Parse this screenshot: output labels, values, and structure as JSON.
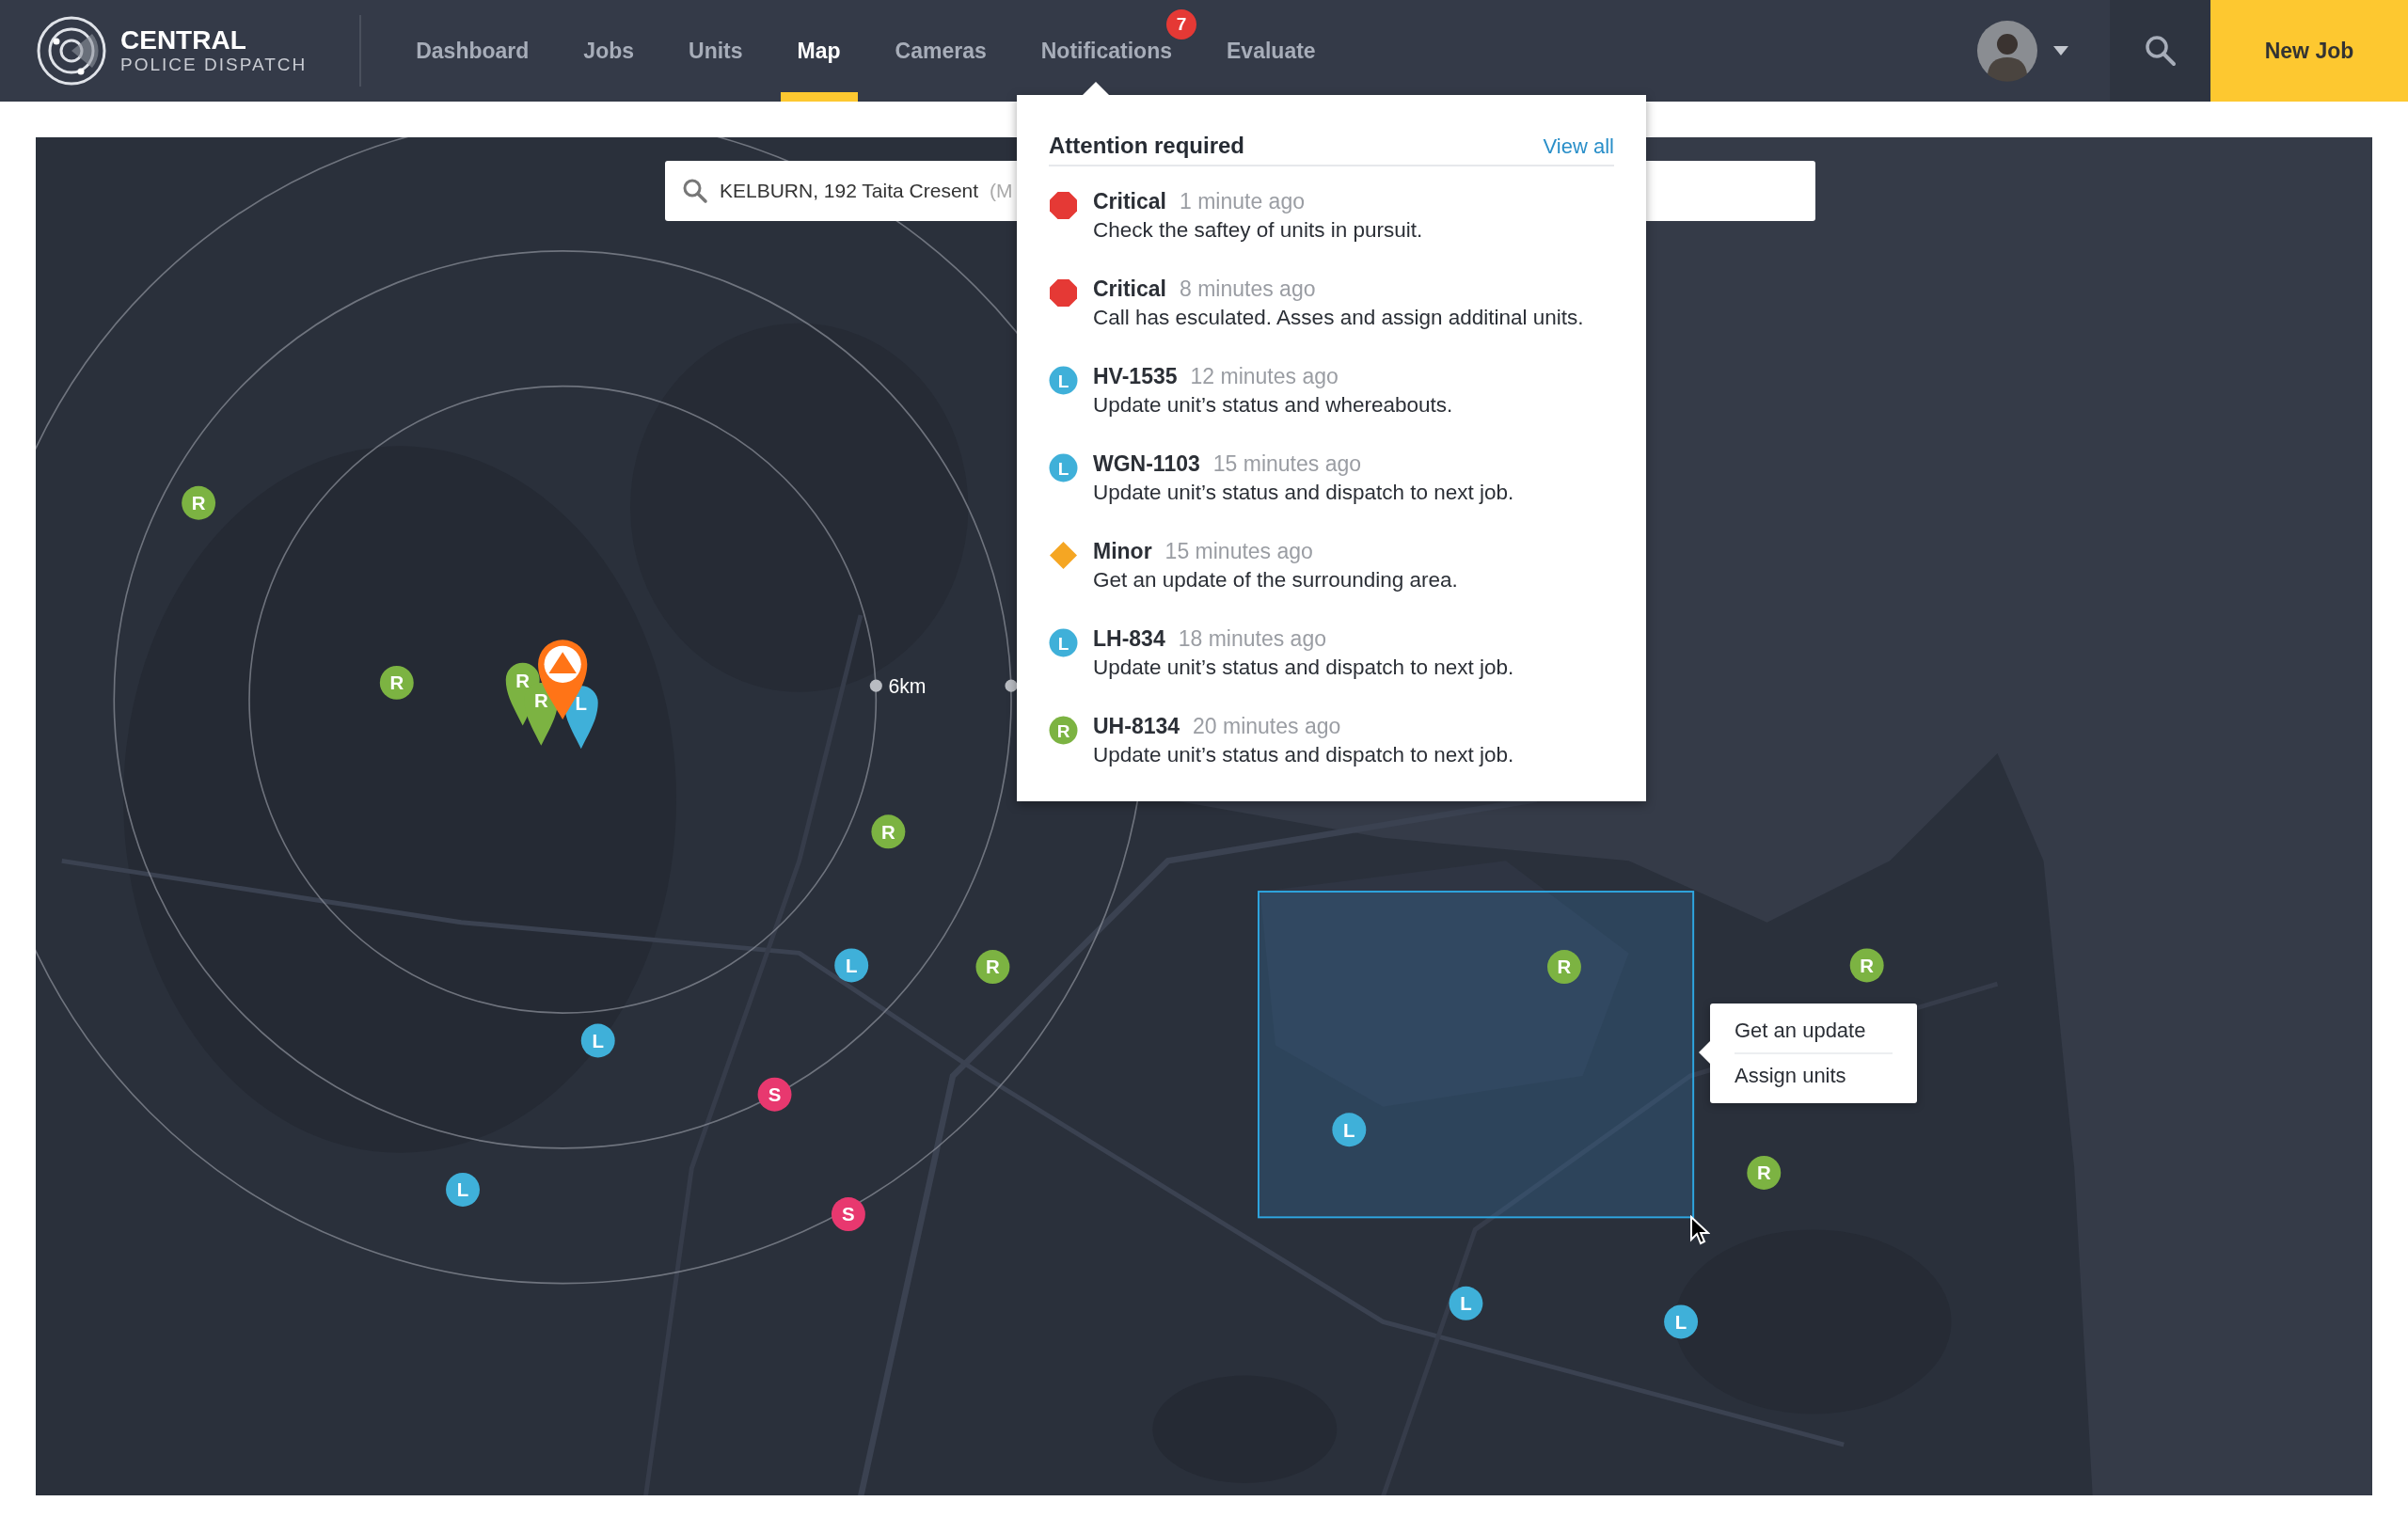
{
  "header": {
    "logo": {
      "title": "CENTRAL",
      "subtitle": "POLICE DISPATCH"
    },
    "nav": [
      {
        "label": "Dashboard",
        "selected": false
      },
      {
        "label": "Jobs",
        "selected": false
      },
      {
        "label": "Units",
        "selected": false
      },
      {
        "label": "Map",
        "selected": true
      },
      {
        "label": "Cameras",
        "selected": false
      },
      {
        "label": "Notifications",
        "selected": false,
        "badge": "7"
      },
      {
        "label": "Evaluate",
        "selected": false
      }
    ],
    "new_job": "New Job"
  },
  "notifications": {
    "title": "Attention required",
    "view_all": "View all",
    "items": [
      {
        "kind": "critical",
        "color": "#e53935",
        "title": "Critical",
        "time": "1 minute ago",
        "message": "Check the saftey of units in pursuit."
      },
      {
        "kind": "critical",
        "color": "#e53935",
        "title": "Critical",
        "time": "8 minutes ago",
        "message": "Call has esculated. Asses and assign additinal units."
      },
      {
        "kind": "unit",
        "color": "#3fb0d9",
        "letter": "L",
        "title": "HV-1535",
        "time": "12 minutes ago",
        "message": "Update unit’s status and whereabouts."
      },
      {
        "kind": "unit",
        "color": "#3fb0d9",
        "letter": "L",
        "title": "WGN-1103",
        "time": "15 minutes ago",
        "message": "Update unit’s status and dispatch to next job."
      },
      {
        "kind": "minor",
        "color": "#f5a623",
        "title": "Minor",
        "time": "15 minutes ago",
        "message": "Get an update of the surrounding area."
      },
      {
        "kind": "unit",
        "color": "#3fb0d9",
        "letter": "L",
        "title": "LH-834",
        "time": "18 minutes ago",
        "message": "Update unit’s status and dispatch to next job."
      },
      {
        "kind": "unit",
        "color": "#7cb342",
        "letter": "R",
        "title": "UH-8134",
        "time": "20 minutes ago",
        "message": "Update unit’s status and dispatch to next job."
      }
    ]
  },
  "map": {
    "search": {
      "value": "KELBURN, 192 Taita Cresent",
      "hint": "(M"
    },
    "distance_label": "6km",
    "pins": [
      {
        "kind": "unit",
        "label": "R",
        "color": "#7cb342"
      },
      {
        "kind": "unit",
        "label": "R",
        "color": "#7cb342"
      },
      {
        "kind": "unit",
        "label": "L",
        "color": "#3fb0d9"
      },
      {
        "kind": "alert",
        "color": "#ff7417"
      }
    ],
    "units": [
      {
        "label": "R",
        "color": "#7cb342"
      },
      {
        "label": "R",
        "color": "#7cb342"
      },
      {
        "label": "R",
        "color": "#7cb342"
      },
      {
        "label": "R",
        "color": "#7cb342"
      },
      {
        "label": "R",
        "color": "#7cb342"
      },
      {
        "label": "R",
        "color": "#7cb342"
      },
      {
        "label": "R",
        "color": "#7cb342"
      },
      {
        "label": "L",
        "color": "#3fb0d9"
      },
      {
        "label": "L",
        "color": "#3fb0d9"
      },
      {
        "label": "L",
        "color": "#3fb0d9"
      },
      {
        "label": "L",
        "color": "#3fb0d9"
      },
      {
        "label": "L",
        "color": "#3fb0d9"
      },
      {
        "label": "L",
        "color": "#3fb0d9"
      },
      {
        "label": "S",
        "color": "#e8386f"
      },
      {
        "label": "S",
        "color": "#e8386f"
      }
    ],
    "context_menu": [
      "Get an update",
      "Assign units"
    ]
  }
}
